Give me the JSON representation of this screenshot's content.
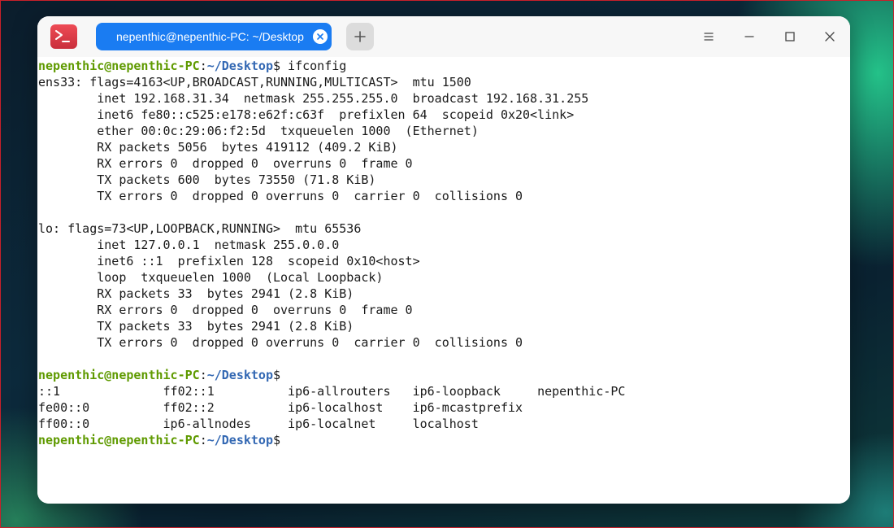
{
  "colors": {
    "accent": "#1a7cf2",
    "prompt_user": "#5f9a00",
    "prompt_path": "#3368b3",
    "app_icon": "#e0424d"
  },
  "titlebar": {
    "app_icon": "terminal-icon",
    "tab_title": "nepenthic@nepenthic-PC: ~/Desktop",
    "tab_close_icon": "close-icon",
    "new_tab_icon": "plus-icon",
    "menu_icon": "hamburger-menu-icon",
    "minimize_icon": "minimize-icon",
    "maximize_icon": "maximize-icon",
    "close_icon": "close-icon"
  },
  "terminal": {
    "prompt": {
      "user_host": "nepenthic@nepenthic-PC",
      "colon": ":",
      "path": "~/Desktop",
      "symbol": "$"
    },
    "command_1": " ifconfig",
    "output_1": [
      "ens33: flags=4163<UP,BROADCAST,RUNNING,MULTICAST>  mtu 1500",
      "        inet 192.168.31.34  netmask 255.255.255.0  broadcast 192.168.31.255",
      "        inet6 fe80::c525:e178:e62f:c63f  prefixlen 64  scopeid 0x20<link>",
      "        ether 00:0c:29:06:f2:5d  txqueuelen 1000  (Ethernet)",
      "        RX packets 5056  bytes 419112 (409.2 KiB)",
      "        RX errors 0  dropped 0  overruns 0  frame 0",
      "        TX packets 600  bytes 73550 (71.8 KiB)",
      "        TX errors 0  dropped 0 overruns 0  carrier 0  collisions 0",
      "",
      "lo: flags=73<UP,LOOPBACK,RUNNING>  mtu 65536",
      "        inet 127.0.0.1  netmask 255.0.0.0",
      "        inet6 ::1  prefixlen 128  scopeid 0x10<host>",
      "        loop  txqueuelen 1000  (Local Loopback)",
      "        RX packets 33  bytes 2941 (2.8 KiB)",
      "        RX errors 0  dropped 0  overruns 0  frame 0",
      "        TX packets 33  bytes 2941 (2.8 KiB)",
      "        TX errors 0  dropped 0 overruns 0  carrier 0  collisions 0",
      ""
    ],
    "command_2": "",
    "output_2": [
      "::1              ff02::1          ip6-allrouters   ip6-loopback     nepenthic-PC",
      "fe00::0          ff02::2          ip6-localhost    ip6-mcastprefix",
      "ff00::0          ip6-allnodes     ip6-localnet     localhost"
    ],
    "command_3": ""
  }
}
